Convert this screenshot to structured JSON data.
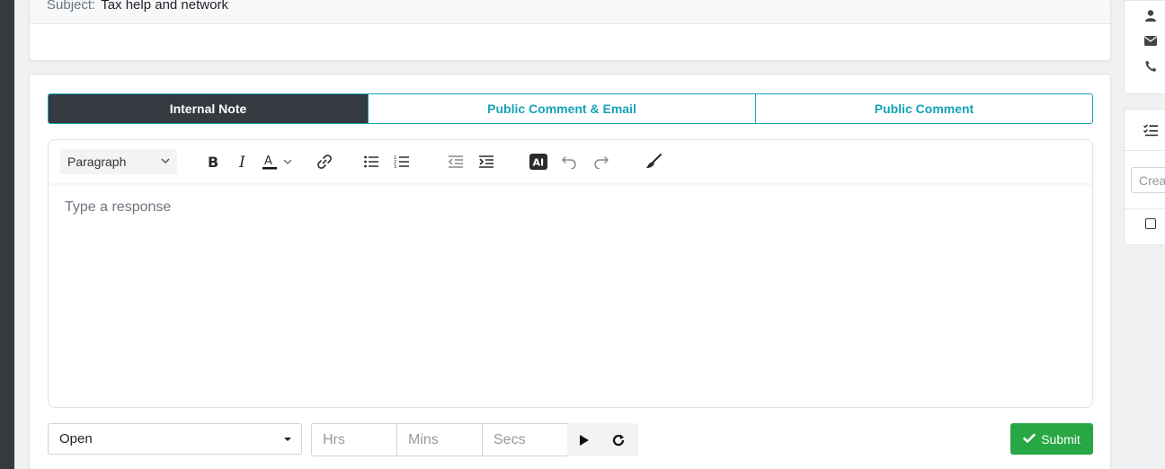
{
  "subject": {
    "label": "Subject:",
    "value": "Tax help and network"
  },
  "tabs": [
    {
      "label": "Internal Note",
      "active": true
    },
    {
      "label": "Public Comment & Email",
      "active": false
    },
    {
      "label": "Public Comment",
      "active": false
    }
  ],
  "editor": {
    "block_format": "Paragraph",
    "placeholder": "Type a response",
    "toolbar_icons": [
      "bold-icon",
      "italic-icon",
      "text-color-icon",
      "link-icon",
      "bullet-list-icon",
      "numbered-list-icon",
      "outdent-icon",
      "indent-icon",
      "ai-icon",
      "undo-icon",
      "redo-icon",
      "clear-format-icon"
    ],
    "ai_label": "AI"
  },
  "footer": {
    "status": "Open",
    "hrs_placeholder": "Hrs",
    "mins_placeholder": "Mins",
    "secs_placeholder": "Secs",
    "submit_label": "Submit"
  },
  "right_panel": {
    "create_placeholder": "Crea",
    "icons": [
      "user-icon",
      "envelope-icon",
      "phone-icon",
      "checklist-icon"
    ]
  },
  "colors": {
    "accent": "#17a2b8",
    "active_tab": "#343a40",
    "submit": "#28a745"
  }
}
